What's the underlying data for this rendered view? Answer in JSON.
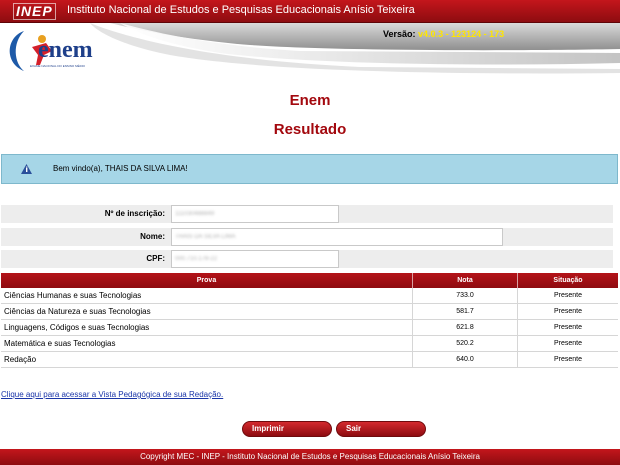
{
  "topbar": {
    "logo_text": "INEP",
    "institution": "Instituto Nacional de Estudos e Pesquisas Educacionais Anísio Teixeira"
  },
  "header": {
    "version_label": "Versão:",
    "version_number": "v4.0.3 - 123124 - 173",
    "logo_text": "enem",
    "logo_subtext": "EXAME NACIONAL DO ENSINO MÉDIO"
  },
  "page": {
    "title": "Enem",
    "subtitle": "Resultado"
  },
  "welcome": {
    "message": "Bem vindo(a), THAIS DA SILVA LIMA!"
  },
  "fields": {
    "inscricao": {
      "label": "Nº de inscrição:",
      "value": "111030488849"
    },
    "nome": {
      "label": "Nome:",
      "value": "THAIS DA SILVA LIMA"
    },
    "cpf": {
      "label": "CPF:",
      "value": "000.710.178-22"
    }
  },
  "results": {
    "headers": [
      "Prova",
      "Nota",
      "Situação"
    ],
    "rows": [
      {
        "prova": "Ciências Humanas e suas Tecnologias",
        "nota": "733.0",
        "situacao": "Presente"
      },
      {
        "prova": "Ciências da Natureza e suas Tecnologias",
        "nota": "581.7",
        "situacao": "Presente"
      },
      {
        "prova": "Linguagens, Códigos e suas Tecnologias",
        "nota": "621.8",
        "situacao": "Presente"
      },
      {
        "prova": "Matemática e suas Tecnologias",
        "nota": "520.2",
        "situacao": "Presente"
      },
      {
        "prova": "Redação",
        "nota": "640.0",
        "situacao": "Presente"
      }
    ]
  },
  "links": {
    "vista_pedagogica": "Clique aqui para acessar a Vista Pedagógica de sua Redação."
  },
  "buttons": {
    "print": "Imprimir",
    "exit": "Sair"
  },
  "footer": {
    "copyright": "Copyright MEC - INEP - Instituto Nacional de Estudos e Pesquisas Educacionais Anísio Teixeira"
  },
  "colors": {
    "brand_red": "#a3080e",
    "info_blue": "#a6d6e7",
    "version_yellow": "#ffe600"
  }
}
